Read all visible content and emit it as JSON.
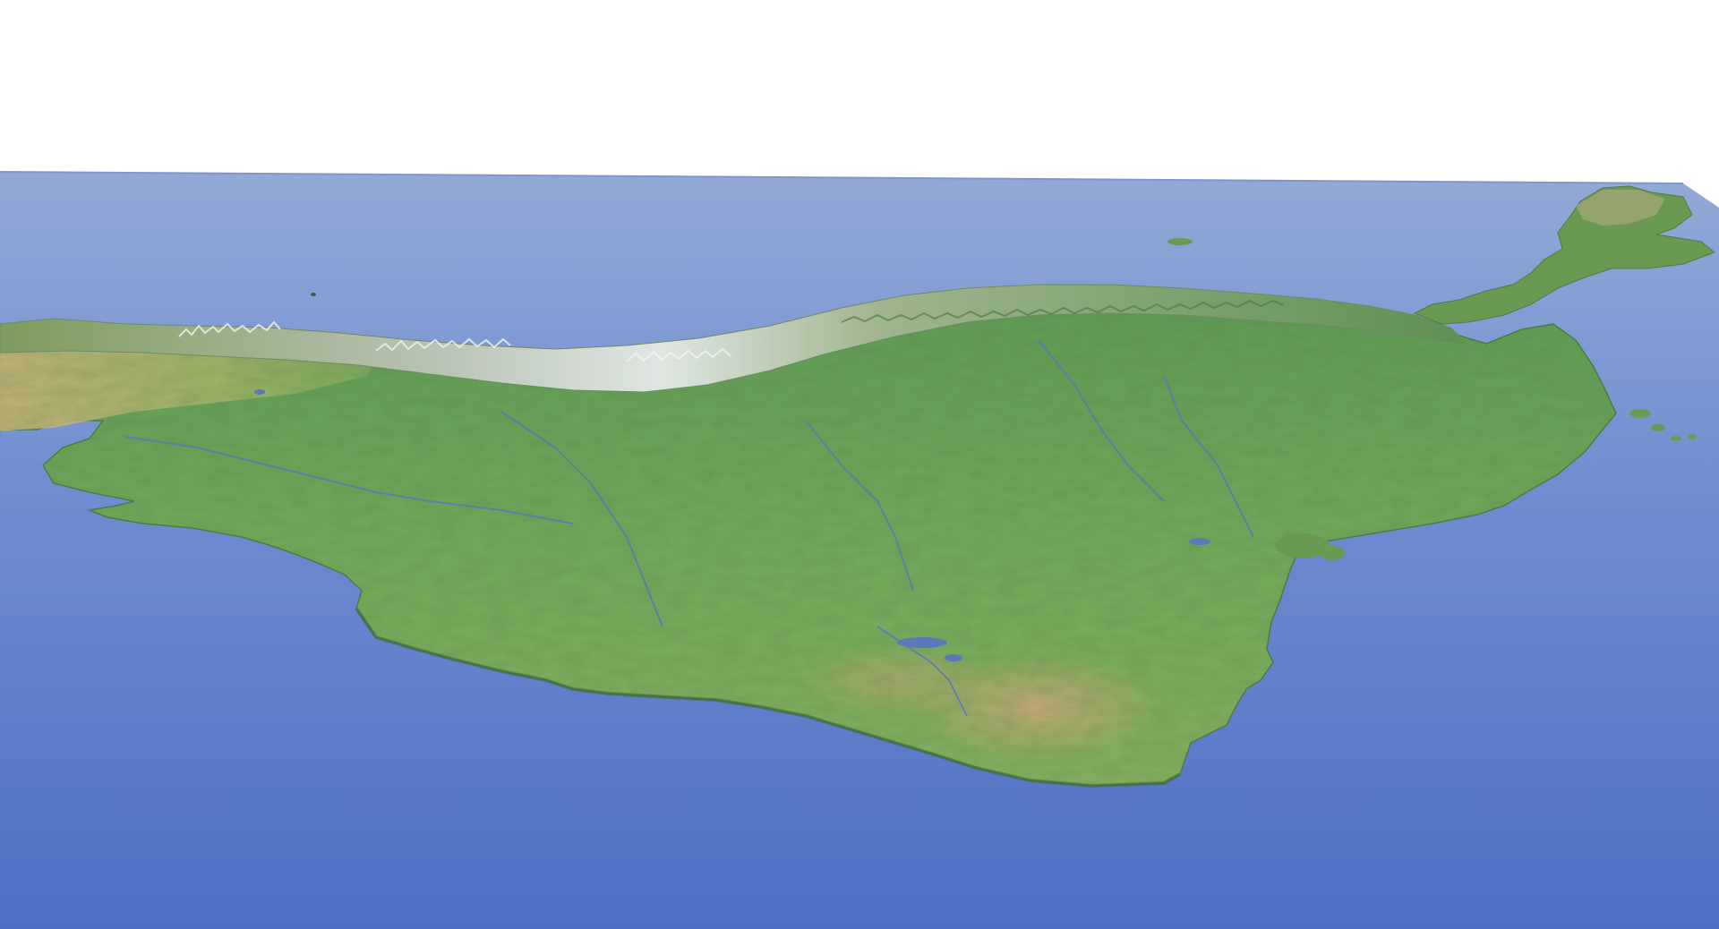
{
  "scene": {
    "colors": {
      "background": "#ffffff",
      "ocean_far": "#8fa6d4",
      "ocean_near": "#5574c6",
      "lowland_green": "#6fa35a",
      "upland_tan": "#c9b07a",
      "mountain_snow": "#e6ece8",
      "river": "#5b78b8",
      "slab_edge": "#7e97c9"
    },
    "features": {
      "land": "landmass",
      "mountain_range": "mountain-range",
      "rivers": "river-network",
      "islands": "offshore-islands"
    }
  }
}
